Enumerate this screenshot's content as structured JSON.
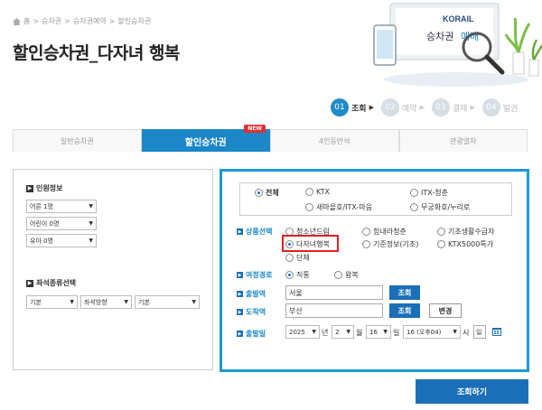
{
  "breadcrumb": [
    "홈",
    "승차권",
    "승차권예약",
    "할인승차권"
  ],
  "page_title": "할인승차권_다자녀 행복",
  "banner": {
    "logo": "KORAIL",
    "text_main": "승차권",
    "text_accent": "예매"
  },
  "steps": [
    {
      "num": "01",
      "label": "조회",
      "active": true
    },
    {
      "num": "02",
      "label": "예약",
      "active": false
    },
    {
      "num": "03",
      "label": "결제",
      "active": false
    },
    {
      "num": "04",
      "label": "발권",
      "active": false
    }
  ],
  "tabs": [
    {
      "label": "일반승차권",
      "active": false
    },
    {
      "label": "할인승차권",
      "active": true,
      "badge": "NEW"
    },
    {
      "label": "4인동반석",
      "active": false
    },
    {
      "label": "관광열차",
      "active": false
    }
  ],
  "passengers": {
    "heading": "인원정보",
    "adult": "어른 1명",
    "child": "어린이 0명",
    "infant": "유아 0명"
  },
  "seat": {
    "heading": "좌석종류선택",
    "type": "기본",
    "direction": "좌석방향",
    "position": "기본"
  },
  "train_types": {
    "all": "전체",
    "ktx": "KTX",
    "itx_chungchun": "ITX-청춘",
    "saemaeul": "새마을호/ITX-마음",
    "mugunghwa": "무궁화호/누리로"
  },
  "products": {
    "label": "상품선택",
    "items": [
      "청소년드림",
      "힘내라청춘",
      "기초생활수급자",
      "다자녀행복",
      "기준정보(기초)",
      "KTX5000특가",
      "단체"
    ],
    "selected": "다자녀행복"
  },
  "journey": {
    "label": "여정경로",
    "direct": "직통",
    "roundtrip": "왕복",
    "selected": "직통"
  },
  "departure": {
    "label": "출발역",
    "value": "서울",
    "search": "조회"
  },
  "arrival": {
    "label": "도착역",
    "value": "부산",
    "search": "조회",
    "swap": "변경"
  },
  "date": {
    "label": "출발일",
    "year": "2025",
    "year_unit": "년",
    "month": "2",
    "month_unit": "월",
    "day": "16",
    "day_unit": "일",
    "hour": "16 (오후04)",
    "hour_unit": "시",
    "weekday": "일"
  },
  "submit": "조회하기",
  "colors": {
    "accent": "#1b87c7",
    "primary_button": "#1b6fb8",
    "highlight": "#e02020"
  }
}
